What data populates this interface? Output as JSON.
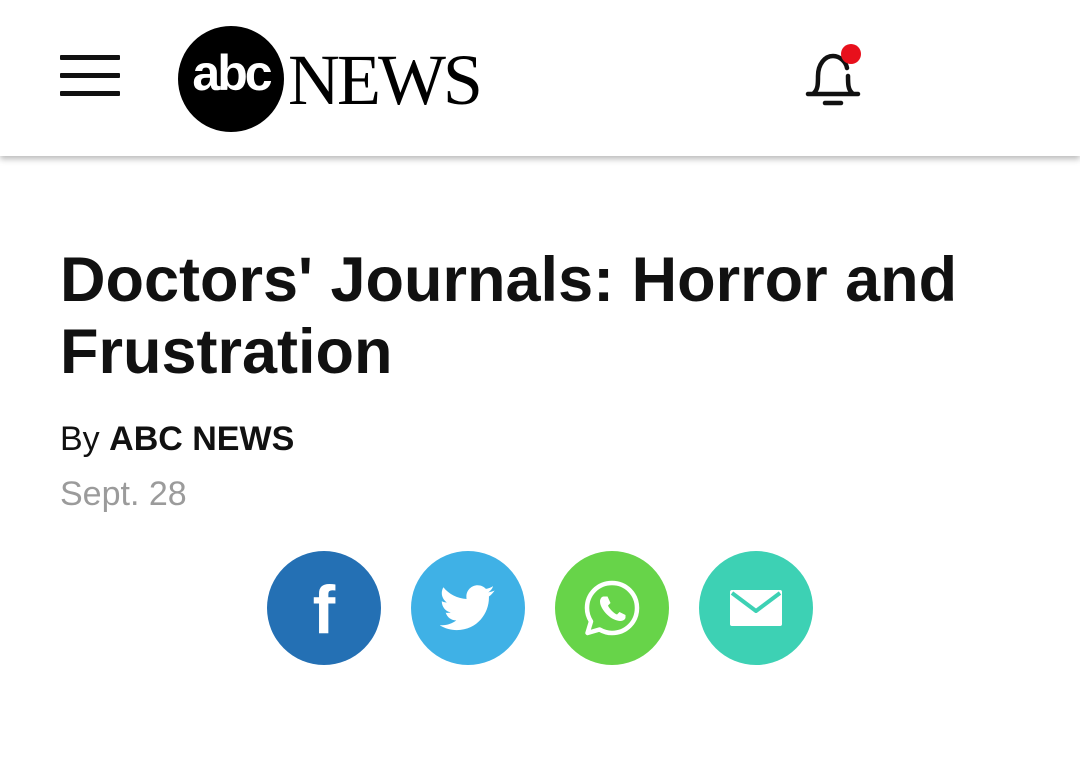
{
  "header": {
    "menu_icon": "hamburger-menu-icon",
    "logo": {
      "mark": "abc",
      "wordmark": "NEWS"
    },
    "notifications_icon": "bell-icon",
    "notification_indicator_color": "#e8101c"
  },
  "article": {
    "headline": "Doctors' Journals: Horror and Frustration",
    "byline_prefix": "By",
    "author": "ABC NEWS",
    "date": "Sept. 28"
  },
  "share": {
    "buttons": [
      {
        "id": "facebook",
        "icon": "facebook-icon",
        "glyph": "f",
        "color": "#2470b4"
      },
      {
        "id": "twitter",
        "icon": "twitter-bird-icon",
        "color": "#3fb1e6"
      },
      {
        "id": "whatsapp",
        "icon": "whatsapp-icon",
        "color": "#67d449"
      },
      {
        "id": "email",
        "icon": "envelope-icon",
        "color": "#3dd1b4"
      }
    ]
  }
}
